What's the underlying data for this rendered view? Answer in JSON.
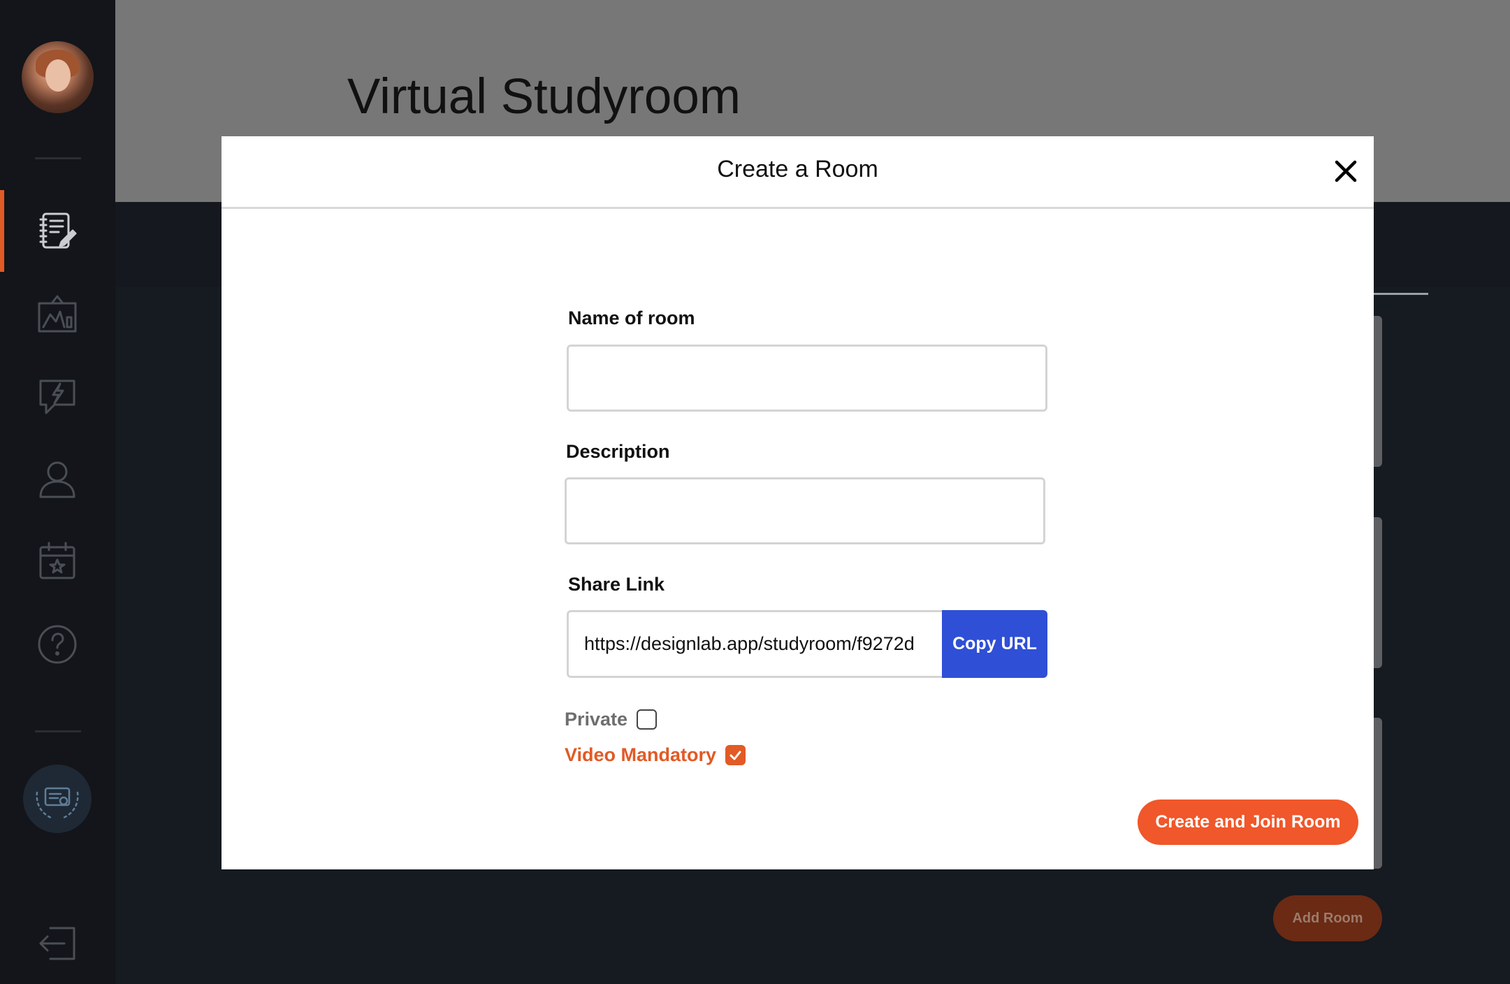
{
  "page": {
    "title": "Virtual Studyroom",
    "add_room_label": "Add Room"
  },
  "sidebar": {
    "icons": [
      "notebook-icon",
      "chart-board-icon",
      "flash-chat-icon",
      "user-icon",
      "calendar-star-icon",
      "help-icon"
    ],
    "active_item": "notebook-icon",
    "accent_color": "#e25a25"
  },
  "modal": {
    "title": "Create a Room",
    "name_label": "Name of room",
    "name_value": "",
    "description_label": "Description",
    "description_value": "",
    "share_label": "Share Link",
    "share_url": "https://designlab.app/studyroom/f9272d",
    "copy_label": "Copy URL",
    "private_label": "Private",
    "private_checked": false,
    "video_label": "Video Mandatory",
    "video_checked": true,
    "submit_label": "Create and Join Room"
  },
  "colors": {
    "primary_button": "#f0572a",
    "copy_button": "#2f4fd6"
  }
}
